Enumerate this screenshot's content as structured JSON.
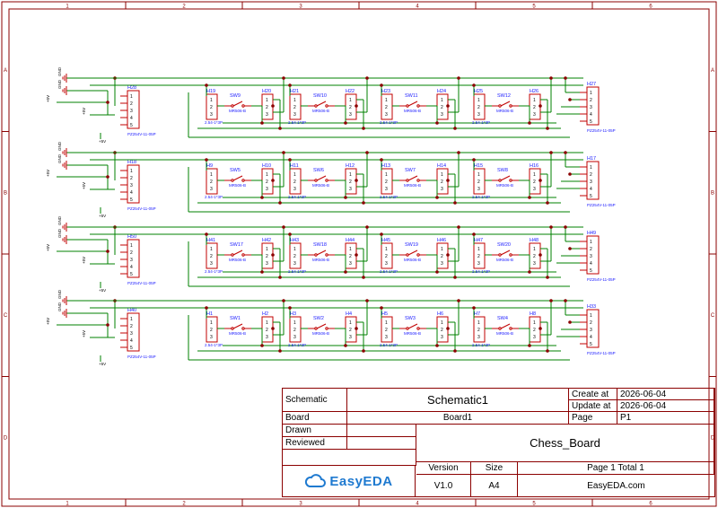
{
  "frame": {
    "columns": [
      "1",
      "2",
      "3",
      "4",
      "5",
      "6"
    ],
    "rows": [
      "A",
      "B",
      "C",
      "D"
    ]
  },
  "rows": [
    {
      "left_header": "H28",
      "right_header": "H27",
      "stages": [
        {
          "header": "H19",
          "switch": "SW9",
          "mid": "H20"
        },
        {
          "header": "H21",
          "switch": "SW10",
          "mid": "H22"
        },
        {
          "header": "H23",
          "switch": "SW11",
          "mid": "H24"
        },
        {
          "header": "H25",
          "switch": "SW12",
          "mid": "H26"
        }
      ]
    },
    {
      "left_header": "H18",
      "right_header": "H17",
      "stages": [
        {
          "header": "H9",
          "switch": "SW5",
          "mid": "H10"
        },
        {
          "header": "H11",
          "switch": "SW6",
          "mid": "H12"
        },
        {
          "header": "H13",
          "switch": "SW7",
          "mid": "H14"
        },
        {
          "header": "H15",
          "switch": "SW8",
          "mid": "H16"
        }
      ]
    },
    {
      "left_header": "H50",
      "right_header": "H49",
      "stages": [
        {
          "header": "H41",
          "switch": "SW17",
          "mid": "H42"
        },
        {
          "header": "H43",
          "switch": "SW18",
          "mid": "H44"
        },
        {
          "header": "H45",
          "switch": "SW19",
          "mid": "H46"
        },
        {
          "header": "H47",
          "switch": "SW20",
          "mid": "H48"
        }
      ]
    },
    {
      "left_header": "H40",
      "right_header": "H33",
      "stages": [
        {
          "header": "H1",
          "switch": "SW1",
          "mid": "H2"
        },
        {
          "header": "H3",
          "switch": "SW2",
          "mid": "H4"
        },
        {
          "header": "H5",
          "switch": "SW3",
          "mid": "H6"
        },
        {
          "header": "H7",
          "switch": "SW4",
          "mid": "H8"
        }
      ]
    }
  ],
  "labels": {
    "header_part": "2.54-1*3P",
    "switch_part": "MR506-B",
    "five_pin_part": "PZ254V-11-05P",
    "gnd": "GND",
    "v5": "+5V",
    "pins3": [
      "1",
      "2",
      "3"
    ],
    "pins5": [
      "1",
      "2",
      "3",
      "4",
      "5"
    ]
  },
  "title_block": {
    "schematic_label": "Schematic",
    "schematic_name": "Schematic1",
    "create_at_label": "Create at",
    "create_at": "2026-06-04",
    "update_at_label": "Update at",
    "update_at": "2026-06-04",
    "board_label": "Board",
    "board_name": "Board1",
    "page_label": "Page",
    "page_value": "P1",
    "drawn_label": "Drawn",
    "reviewed_label": "Reviewed",
    "title": "Chess_Board",
    "version_label": "Version",
    "version": "V1.0",
    "size_label": "Size",
    "size": "A4",
    "page_total": "Page  1  Total  1",
    "brand": "EasyEDA",
    "site": "EasyEDA.com"
  },
  "colors": {
    "border": "#8b0000",
    "wire": "#008000",
    "component": "#c00000",
    "junction": "#8b0000",
    "text_blue": "#1a1aff",
    "logo": "#1f7ad0"
  }
}
